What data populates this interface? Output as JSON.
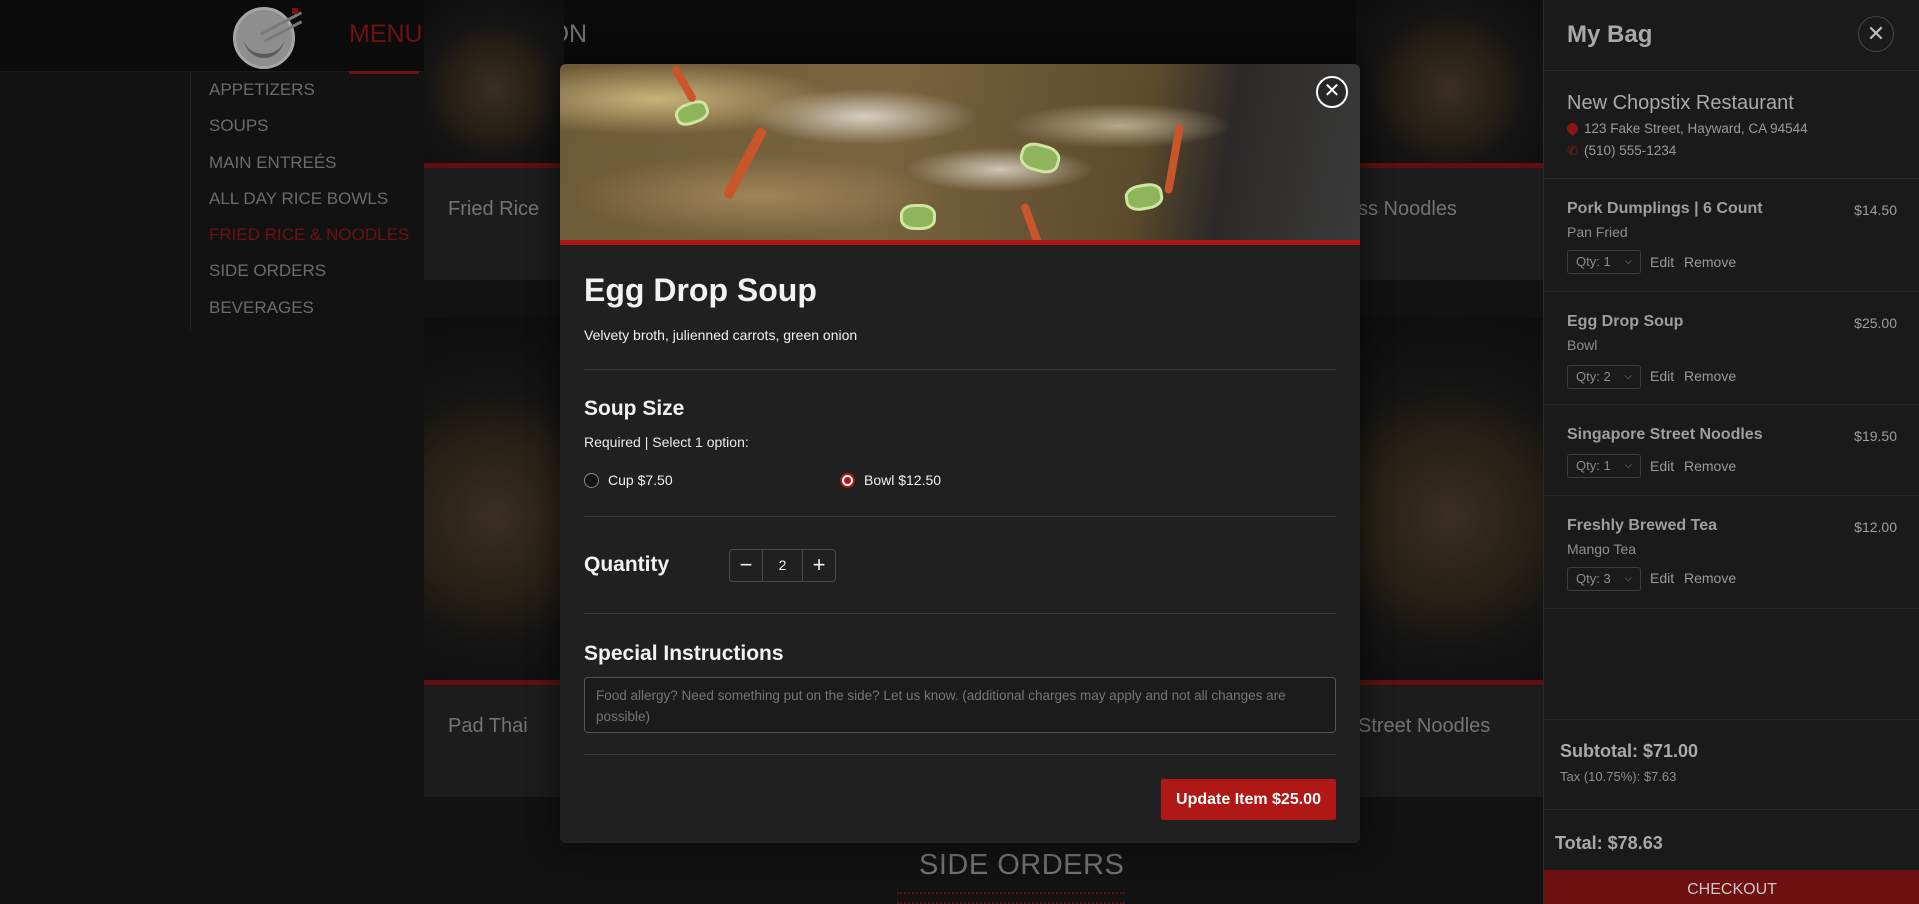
{
  "nav": {
    "menu": "MENU",
    "nutrition": "NUTRITION"
  },
  "categories": [
    "APPETIZERS",
    "SOUPS",
    "MAIN ENTREÉS",
    "ALL DAY RICE BOWLS",
    "FRIED RICE & NOODLES",
    "SIDE ORDERS",
    "BEVERAGES"
  ],
  "active_category": "FRIED RICE & NOODLES",
  "menu_cards": [
    {
      "title": "Fried Rice"
    },
    {
      "title": "ss Noodles"
    },
    {
      "title": "Pad Thai"
    },
    {
      "title": "Street Noodles"
    }
  ],
  "section_heading": "SIDE ORDERS",
  "modal": {
    "title": "Egg Drop Soup",
    "description": "Velvety broth, julienned carrots, green onion",
    "size_heading": "Soup Size",
    "size_requirement": "Required | Select 1 option:",
    "options": [
      {
        "label": "Cup $7.50",
        "selected": false
      },
      {
        "label": "Bowl $12.50",
        "selected": true
      }
    ],
    "quantity_label": "Quantity",
    "quantity": "2",
    "instructions_heading": "Special Instructions",
    "instructions_placeholder": "Food allergy? Need something put on the side? Let us know. (additional charges may apply and not all changes are possible)",
    "update_button": "Update Item $25.00",
    "close_glyph": "✕"
  },
  "bag": {
    "title": "My Bag",
    "close_glyph": "✕",
    "restaurant": "New Chopstix Restaurant",
    "address": "123 Fake Street, Hayward, CA 94544",
    "phone": "(510) 555-1234",
    "items": [
      {
        "name": "Pork Dumplings | 6 Count",
        "price": "$14.50",
        "option": "Pan Fried",
        "qty": "Qty: 1"
      },
      {
        "name": "Egg Drop Soup",
        "price": "$25.00",
        "option": "Bowl",
        "qty": "Qty: 2"
      },
      {
        "name": "Singapore Street Noodles",
        "price": "$19.50",
        "option": "",
        "qty": "Qty: 1"
      },
      {
        "name": "Freshly Brewed Tea",
        "price": "$12.00",
        "option": "Mango Tea",
        "qty": "Qty: 3"
      }
    ],
    "edit_label": "Edit",
    "remove_label": "Remove",
    "subtotal": "Subtotal: $71.00",
    "tax": "Tax (10.75%): $7.63",
    "total": "Total: $78.63",
    "checkout": "CHECKOUT"
  },
  "colors": {
    "accent": "#b01717",
    "modal_bg": "#202020",
    "page_bg": "#121212"
  }
}
